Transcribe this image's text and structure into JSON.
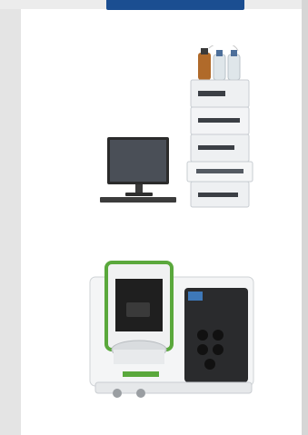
{
  "colors": {
    "page_bg": "#e4e4e4",
    "card_bg": "#ffffff",
    "accent_blue": "#1b4e91",
    "instrument_green": "#5aa83c"
  },
  "products": [
    {
      "icon": "hplc-system-icon"
    },
    {
      "icon": "spectrometer-icon"
    }
  ]
}
